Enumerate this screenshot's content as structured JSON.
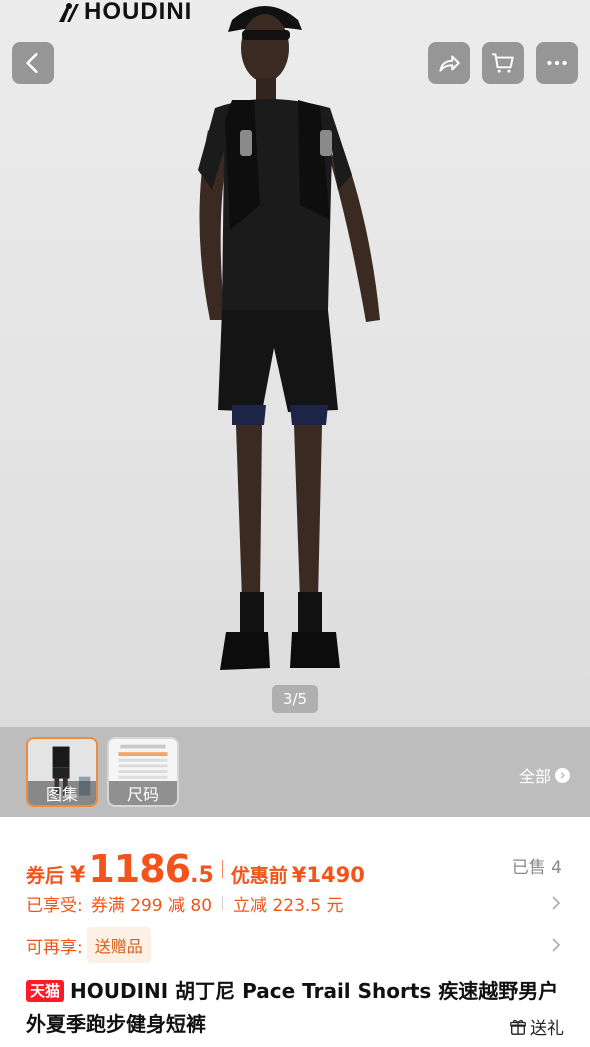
{
  "hero": {
    "brand": "HOUDINI",
    "pager": "3/5"
  },
  "icons": {
    "back": "chevron-left-icon",
    "share": "share-icon",
    "cart": "cart-icon",
    "more": "more-icon"
  },
  "thumbs": {
    "gallery_label": "图集",
    "size_label": "尺码",
    "all_label": "全部"
  },
  "price": {
    "after_label": "券后",
    "currency": "¥",
    "int": "1186",
    "dec": ".5",
    "before_label": "优惠前",
    "before_price": "¥1490",
    "sold": "已售 4"
  },
  "promo": {
    "label": "已享受:",
    "coupon": "券满 299 减 80",
    "discount": "立减 223.5 元"
  },
  "gift": {
    "label": "可再享:",
    "chip": "送赠品"
  },
  "title": {
    "badge": "天猫",
    "text": "HOUDINI 胡丁尼 Pace Trail Shorts 疾速越野男户外夏季跑步健身短裤",
    "gift_button": "送礼"
  },
  "colors": {
    "accent": "#f2541c",
    "tmall": "#ff1a28"
  }
}
